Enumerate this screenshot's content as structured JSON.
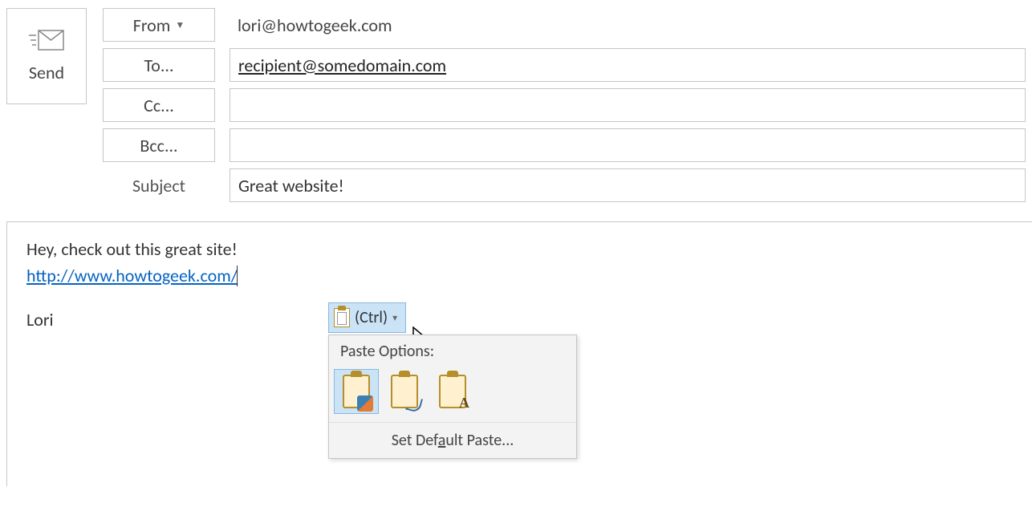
{
  "header": {
    "send_label": "Send",
    "from_label": "From",
    "from_value": "lori@howtogeek.com",
    "to_label": "To...",
    "to_value": "recipient@somedomain.com",
    "cc_label": "Cc...",
    "cc_value": "",
    "bcc_label": "Bcc...",
    "bcc_value": "",
    "subject_label": "Subject",
    "subject_value": "Great website!"
  },
  "body": {
    "line1": "Hey, check out this great site!",
    "link": "http://www.howtogeek.com/",
    "signature": "Lori"
  },
  "smart_tag": {
    "label": "(Ctrl)"
  },
  "paste_popup": {
    "header": "Paste Options:",
    "opt1_name": "keep-source-formatting",
    "opt2_name": "merge-formatting",
    "opt3_name": "keep-text-only",
    "footer_prefix": "Set Def",
    "footer_u": "a",
    "footer_suffix": "ult Paste..."
  }
}
